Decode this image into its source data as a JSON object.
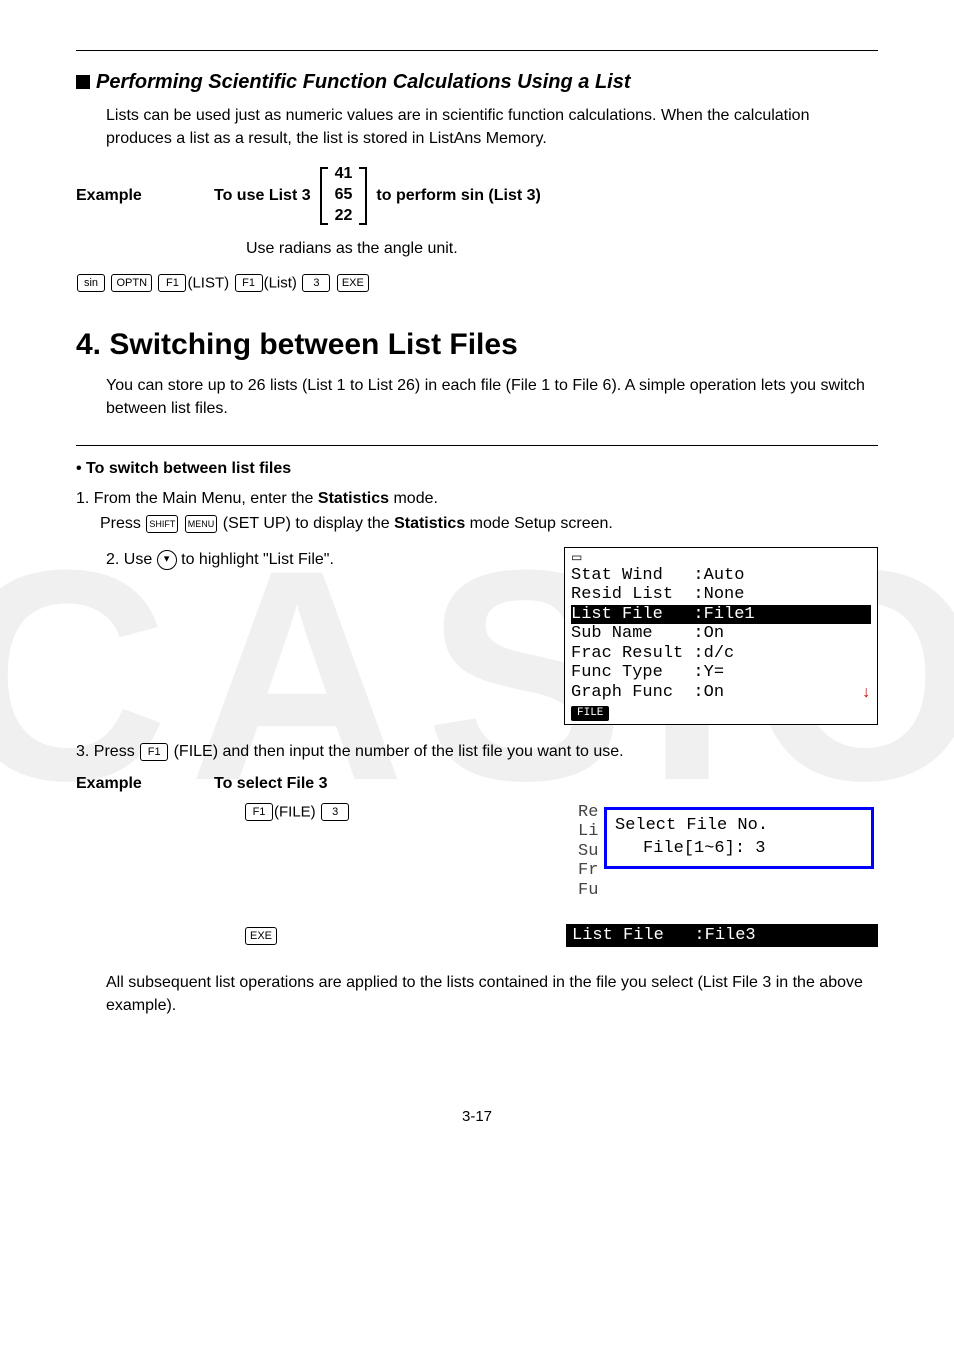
{
  "watermark": "CASIO",
  "section1": {
    "heading": "Performing Scientific Function Calculations Using a List",
    "intro": "Lists can be used just as numeric values are in scientific function calculations. When the calculation produces a list as a result, the list is stored in ListAns Memory.",
    "exampleLabel": "Example",
    "exampleLead": "To use List 3",
    "matrix": [
      "41",
      "65",
      "22"
    ],
    "exampleTail": "to perform sin (List 3)",
    "note": "Use radians as the angle unit.",
    "keys": {
      "sin": "sin",
      "optn": "OPTN",
      "f1": "F1",
      "list1": "(LIST)",
      "f1b": "F1",
      "list2": "(List)",
      "k3": "3",
      "exe": "EXE"
    }
  },
  "section2": {
    "heading": "4. Switching between List Files",
    "intro": "You can store up to 26 lists (List 1 to List 26) in each file (File 1 to File 6). A simple operation lets you switch between list files.",
    "bulletHead": "• To switch between list files",
    "step1_a": "1. From the Main Menu, enter the ",
    "step1_b": "Statistics",
    "step1_c": " mode.",
    "step1s_a": "Press ",
    "step1s_shift": "SHIFT",
    "step1s_menu": "MENU",
    "step1s_b": "(SET UP) to display the ",
    "step1s_c": "Statistics",
    "step1s_d": " mode Setup screen.",
    "step2_a": "2. Use ",
    "step2_b": " to highlight \"List File\".",
    "lcd": {
      "l1": "Stat Wind   :Auto",
      "l2": "Resid List  :None",
      "l3": "List File   :File1",
      "l4": "Sub Name    :On",
      "l5": "Frac Result :d/c",
      "l6": "Func Type   :Y=",
      "l7": "Graph Func  :On",
      "softkey": "FILE"
    },
    "step3_a": "3. Press ",
    "step3_f1": "F1",
    "step3_b": "(FILE) and then input the number of the list file you want to use.",
    "ex2Label": "Example",
    "ex2Text": "To select File 3",
    "ex2Keys": {
      "f1": "F1",
      "file": "(FILE)",
      "k3": "3"
    },
    "dialog": {
      "bgcol": "Re\nLi\nSu\nFr\nFu",
      "title": "Select File No.",
      "input": "File[1~6]: 3"
    },
    "exeKey": "EXE",
    "result": "List File   :File3",
    "closing": "All subsequent list operations are applied to the lists contained in the file you select (List File 3 in the above example)."
  },
  "pageNumber": "3-17"
}
